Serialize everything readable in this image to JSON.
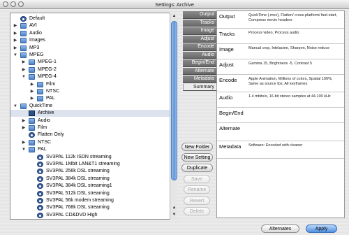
{
  "window": {
    "title": "Settings: Archive"
  },
  "tree": [
    {
      "label": "Default",
      "indent": 0,
      "tri": "",
      "icon": "preset"
    },
    {
      "label": "AVI",
      "indent": 0,
      "tri": "▶",
      "icon": "folder"
    },
    {
      "label": "Audio",
      "indent": 0,
      "tri": "▶",
      "icon": "folder"
    },
    {
      "label": "Images",
      "indent": 0,
      "tri": "▶",
      "icon": "folder"
    },
    {
      "label": "MP3",
      "indent": 0,
      "tri": "▶",
      "icon": "folder"
    },
    {
      "label": "MPEG",
      "indent": 0,
      "tri": "▼",
      "icon": "folder"
    },
    {
      "label": "MPEG-1",
      "indent": 1,
      "tri": "▶",
      "icon": "folder"
    },
    {
      "label": "MPEG-2",
      "indent": 1,
      "tri": "▶",
      "icon": "folder"
    },
    {
      "label": "MPEG-4",
      "indent": 1,
      "tri": "▼",
      "icon": "folder"
    },
    {
      "label": "Film",
      "indent": 2,
      "tri": "▶",
      "icon": "folder"
    },
    {
      "label": "NTSC",
      "indent": 2,
      "tri": "▶",
      "icon": "folder"
    },
    {
      "label": "PAL",
      "indent": 2,
      "tri": "▶",
      "icon": "folder"
    },
    {
      "label": "QuickTime",
      "indent": 0,
      "tri": "▼",
      "icon": "folder"
    },
    {
      "label": "Archive",
      "indent": 1,
      "tri": "",
      "icon": "qtfile",
      "selected": true
    },
    {
      "label": "Audio",
      "indent": 1,
      "tri": "▶",
      "icon": "folder"
    },
    {
      "label": "Film",
      "indent": 1,
      "tri": "▶",
      "icon": "folder"
    },
    {
      "label": "Flatten Only",
      "indent": 1,
      "tri": "",
      "icon": "preset"
    },
    {
      "label": "NTSC",
      "indent": 1,
      "tri": "▶",
      "icon": "folder"
    },
    {
      "label": "PAL",
      "indent": 1,
      "tri": "▼",
      "icon": "folder"
    },
    {
      "label": "SV3PAL 112k ISDN streaming",
      "indent": 2,
      "tri": "",
      "icon": "preset"
    },
    {
      "label": "SV3PAL 1Mbit LAN&T1 streaming",
      "indent": 2,
      "tri": "",
      "icon": "preset"
    },
    {
      "label": "SV3PAL 256k DSL streaming",
      "indent": 2,
      "tri": "",
      "icon": "preset"
    },
    {
      "label": "SV3PAL 384k DSL streaming",
      "indent": 2,
      "tri": "",
      "icon": "preset"
    },
    {
      "label": "SV3PAL 384k DSL streaming1",
      "indent": 2,
      "tri": "",
      "icon": "preset"
    },
    {
      "label": "SV3PAL 512k DSL streaming",
      "indent": 2,
      "tri": "",
      "icon": "preset"
    },
    {
      "label": "SV3PAL 56k modem streaming",
      "indent": 2,
      "tri": "",
      "icon": "preset"
    },
    {
      "label": "SV3PAL 768k DSL streaming",
      "indent": 2,
      "tri": "",
      "icon": "preset"
    },
    {
      "label": "SV3PAL CD&DVD High",
      "indent": 2,
      "tri": "",
      "icon": "preset"
    }
  ],
  "actions": {
    "new_folder": "New Folder",
    "new_setting": "New Setting",
    "duplicate": "Duplicate",
    "save": "Save",
    "rename": "Rename",
    "revert": "Revert",
    "delete": "Delete"
  },
  "tabs": [
    "Output",
    "Tracks",
    "Image",
    "Adjust",
    "Encode",
    "Audio",
    "Begin/End",
    "Alternate",
    "Metadata",
    "Summary"
  ],
  "active_tab": "Summary",
  "summary": [
    {
      "label": "Output",
      "value": "QuickTime (.mov), Flatten/ cross-platform/ fast-start,  Compress movie headers"
    },
    {
      "label": "Tracks",
      "value": "Process video, Process audio"
    },
    {
      "label": "Image",
      "value": "Manual crop, Intelacine, Sharpen, Noise reduce"
    },
    {
      "label": "Adjust",
      "value": "Gamma 15, Brightness -5, Contrast 5"
    },
    {
      "label": "Encode",
      "value": "Apple Animation, Millions of colors, Spatial 100%, Same as source fps, All keyframes"
    },
    {
      "label": "Audio",
      "value": "1.4 mbits/s, 16-bit stereo samples at 44.100 kHz"
    },
    {
      "label": "Begin/End",
      "value": ""
    },
    {
      "label": "Alternate",
      "value": ""
    },
    {
      "label": "Metadata",
      "value": "Software: Encoded with cleaner"
    }
  ],
  "footer": {
    "alternates": "Alternates",
    "apply": "Apply"
  }
}
